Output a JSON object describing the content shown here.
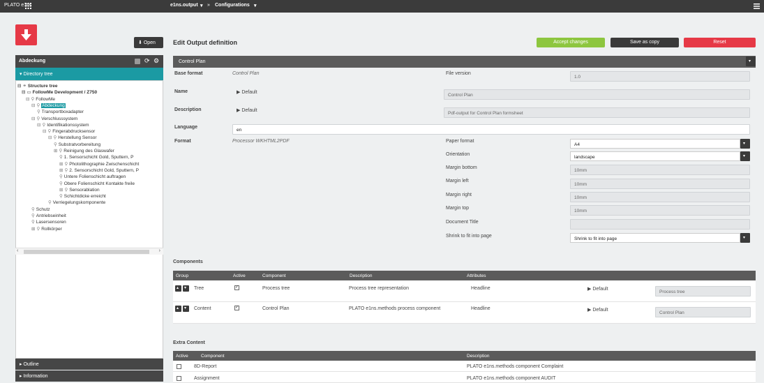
{
  "topbar": {
    "brand": "PLATO e1ns",
    "crumb1": "e1ns.output",
    "sep": "»",
    "crumb2": "Configurations"
  },
  "left": {
    "open_label": "Open",
    "panel_title": "Abdeckung",
    "directory_tree_label": "Directory tree",
    "outline_label": "Outline",
    "information_label": "Information",
    "tree": [
      {
        "label": "Structure tree",
        "toggle": "⊟",
        "icon": "⚭",
        "bold": true,
        "selected": false
      },
      {
        "label": "FollowMe Development / Z750",
        "toggle": "⊟",
        "icon": "▭",
        "bold": true,
        "selected": false
      },
      {
        "label": "FollowMe",
        "toggle": "⊟",
        "icon": "⚲",
        "bold": false,
        "selected": false
      },
      {
        "label": "Abdeckung",
        "toggle": "⊟",
        "icon": "⚲",
        "bold": false,
        "selected": true
      },
      {
        "label": "Transportboxadapter",
        "toggle": "",
        "icon": "⚲",
        "bold": false,
        "selected": false
      },
      {
        "label": "Verschlusssystem",
        "toggle": "⊟",
        "icon": "⚲",
        "bold": false,
        "selected": false
      },
      {
        "label": "Identifikationssystem",
        "toggle": "⊟",
        "icon": "⚲",
        "bold": false,
        "selected": false
      },
      {
        "label": "Fingerabdrucksensor",
        "toggle": "⊟",
        "icon": "⚲",
        "bold": false,
        "selected": false
      },
      {
        "label": "Herstellung Sensor",
        "toggle": "⊟",
        "icon": "⚲",
        "bold": false,
        "selected": false
      },
      {
        "label": "Substratvorbereitung",
        "toggle": "",
        "icon": "⚲",
        "bold": false,
        "selected": false
      },
      {
        "label": "Reinigung des Glaswafer",
        "toggle": "⊞",
        "icon": "⚲",
        "bold": false,
        "selected": false
      },
      {
        "label": "1. Sensorschicht Gold, Sputtern, P",
        "toggle": "",
        "icon": "⚲",
        "bold": false,
        "selected": false
      },
      {
        "label": "Photolithographie Zwischenschicht",
        "toggle": "⊞",
        "icon": "⚲",
        "bold": false,
        "selected": false
      },
      {
        "label": "2. Sensorschicht Gold, Sputtern, P",
        "toggle": "⊞",
        "icon": "⚲",
        "bold": false,
        "selected": false
      },
      {
        "label": "Untere Folienschicht auftragen",
        "toggle": "",
        "icon": "⚲",
        "bold": false,
        "selected": false
      },
      {
        "label": "Obere Folienschicht Kontakte freile",
        "toggle": "",
        "icon": "⚲",
        "bold": false,
        "selected": false
      },
      {
        "label": "Sensorablation",
        "toggle": "⊞",
        "icon": "⚲",
        "bold": false,
        "selected": false
      },
      {
        "label": "Schichtdicke erreicht",
        "toggle": "",
        "icon": "⚲",
        "bold": false,
        "selected": false
      },
      {
        "label": "Verriegelungskomponente",
        "toggle": "",
        "icon": "⚲",
        "bold": false,
        "selected": false
      },
      {
        "label": "Schutz",
        "toggle": "",
        "icon": "⚲",
        "bold": false,
        "selected": false
      },
      {
        "label": "Antriebseinheit",
        "toggle": "",
        "icon": "⚲",
        "bold": false,
        "selected": false
      },
      {
        "label": "Lasersensoren",
        "toggle": "",
        "icon": "⚲",
        "bold": false,
        "selected": false
      },
      {
        "label": "Rollkörper",
        "toggle": "⊞",
        "icon": "⚲",
        "bold": false,
        "selected": false
      }
    ]
  },
  "main": {
    "title": "Edit Output definition",
    "accept_label": "Accept changes",
    "save_copy_label": "Save as copy",
    "reset_label": "Reset",
    "panel_select": "Control Plan",
    "base_format_label": "Base format",
    "base_format_value": "Control Plan",
    "file_version_label": "File version",
    "file_version_value": "1.0",
    "name_label": "Name",
    "name_toggle": "Default",
    "name_value": "Control Plan",
    "description_label": "Description",
    "description_toggle": "Default",
    "description_value": "Pdf-output for Control Plan formsheet",
    "language_label": "Language",
    "language_value": "en",
    "format_label": "Format",
    "format_value": "Processor WKHTML2PDF",
    "paper_format_label": "Paper format",
    "paper_format_value": "A4",
    "orientation_label": "Orientation",
    "orientation_value": "landscape",
    "margin_bottom_label": "Margin bottom",
    "margin_bottom_value": "10mm",
    "margin_left_label": "Margin left",
    "margin_left_value": "10mm",
    "margin_right_label": "Margin right",
    "margin_right_value": "10mm",
    "margin_top_label": "Margin top",
    "margin_top_value": "10mm",
    "doc_title_label": "Document Title",
    "doc_title_value": "",
    "shrink_label": "Shrink to fit into page",
    "shrink_value": "Shrink to fit into page"
  },
  "components": {
    "title": "Components",
    "headers": [
      "Group",
      "Active",
      "Component",
      "Description",
      "Attributes"
    ],
    "rows": [
      {
        "group": "Tree",
        "component": "Process tree",
        "description": "Process tree representation",
        "attribute": "Headline",
        "toggle": "Default",
        "value": "Process tree"
      },
      {
        "group": "Content",
        "component": "Control Plan",
        "description": "PLATO e1ns.methods process component",
        "attribute": "Headline",
        "toggle": "Default",
        "value": "Control Plan"
      }
    ]
  },
  "extra": {
    "title": "Extra Content",
    "headers": [
      "Active",
      "Component",
      "Description"
    ],
    "rows": [
      {
        "component": "8D-Report",
        "description": "PLATO e1ns.methods component Complaint"
      },
      {
        "component": "Assignment",
        "description": "PLATO e1ns.methods component AUDIT"
      }
    ]
  },
  "colors": {
    "accept": "#8dc63f",
    "save_copy": "#3a3a3a",
    "reset": "#e63946",
    "teal": "#1b9aa3"
  }
}
